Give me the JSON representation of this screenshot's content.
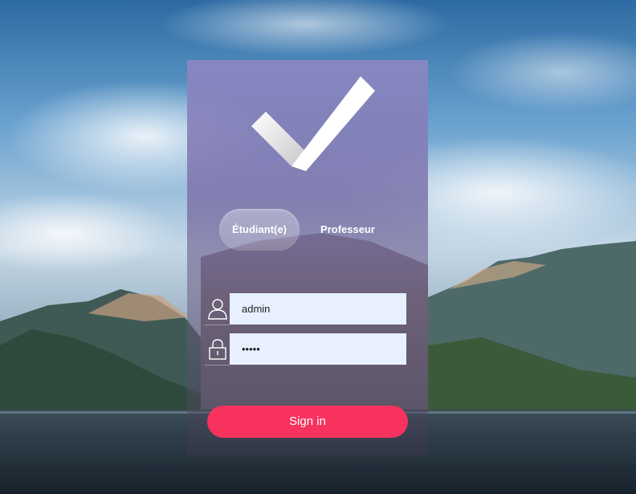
{
  "tabs": {
    "student_label": "Étudiant(e)",
    "professor_label": "Professeur",
    "selected": "Étudiant(e)"
  },
  "form": {
    "username_value": "admin",
    "password_value": "admin"
  },
  "signin": {
    "label": "Sign in"
  },
  "icons": {
    "logo": "checkmark-logo",
    "username": "user-icon",
    "password": "lock-icon"
  },
  "colors": {
    "accent": "#f7325e",
    "input_bg": "#e8f0fd",
    "card_top": "#8c87c3"
  }
}
